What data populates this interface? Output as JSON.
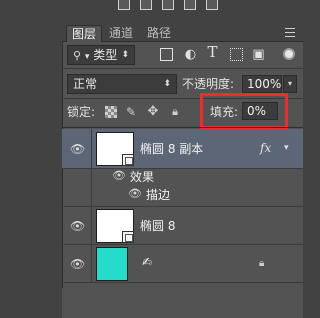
{
  "tabs": [
    {
      "label": "图层",
      "active": true
    },
    {
      "label": "通道",
      "active": false
    },
    {
      "label": "路径",
      "active": false
    }
  ],
  "filter": {
    "kind_label": "类型",
    "icons": [
      "image-filter-icon",
      "adjustment-filter-icon",
      "type-filter-icon",
      "shape-filter-icon",
      "smart-object-filter-icon"
    ],
    "type_glyph": "T"
  },
  "blend": {
    "mode": "正常",
    "opacity_label": "不透明度:",
    "opacity_value": "100%"
  },
  "lock": {
    "label": "锁定:",
    "fill_label": "填充:",
    "fill_value": "0%"
  },
  "layers": [
    {
      "name": "椭圆 8 副本",
      "selected": true,
      "has_fx": true,
      "fx_label": "fx"
    },
    {
      "effects_label": "效果",
      "stroke_label": "描边"
    },
    {
      "name": "椭圆 8",
      "selected": false
    },
    {
      "name": "",
      "thumb_color": "#25dccb",
      "locked": true
    }
  ],
  "colors": {
    "panel_bg": "#535353",
    "selected_row": "#5d6677",
    "highlight": "#e53030",
    "cyan_thumb": "#25dccb"
  }
}
